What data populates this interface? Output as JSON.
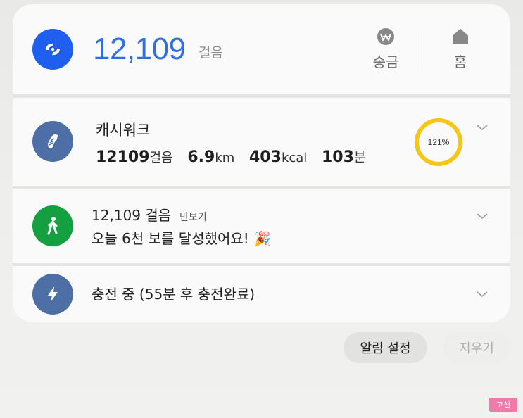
{
  "header": {
    "steps_value": "12,109",
    "steps_unit": "걸음",
    "buttons": [
      {
        "id": "send-money",
        "label": "송금",
        "icon": "won-coin-icon"
      },
      {
        "id": "home",
        "label": "홈",
        "icon": "home-icon"
      }
    ]
  },
  "cards": {
    "cashwalk": {
      "title": "캐시워크",
      "icon": "shoe-icon",
      "stats": [
        {
          "num": "12109",
          "unit": "걸음"
        },
        {
          "num": "6.9",
          "unit": "km"
        },
        {
          "num": "403",
          "unit": "kcal"
        },
        {
          "num": "103",
          "unit": "분"
        }
      ],
      "progress_label": "121%"
    },
    "pedometer": {
      "title": "12,109 걸음",
      "app_name": "만보기",
      "message": "오늘 6천 보를 달성했어요! 🎉",
      "icon": "walking-person-icon"
    },
    "charging": {
      "text": "충전 중 (55분 후 충전완료)",
      "icon": "lightning-icon"
    }
  },
  "actions": {
    "notification_settings": "알림 설정",
    "clear": "지우기"
  },
  "watermark": "고선",
  "colors": {
    "header_icon_bg": "#1f5ff0",
    "cashwalk_icon_bg": "#4e6fa6",
    "pedometer_icon_bg": "#14a040",
    "charging_icon_bg": "#4e6fa6",
    "steps_text": "#2f6fe0",
    "ring": "#f5c518"
  }
}
